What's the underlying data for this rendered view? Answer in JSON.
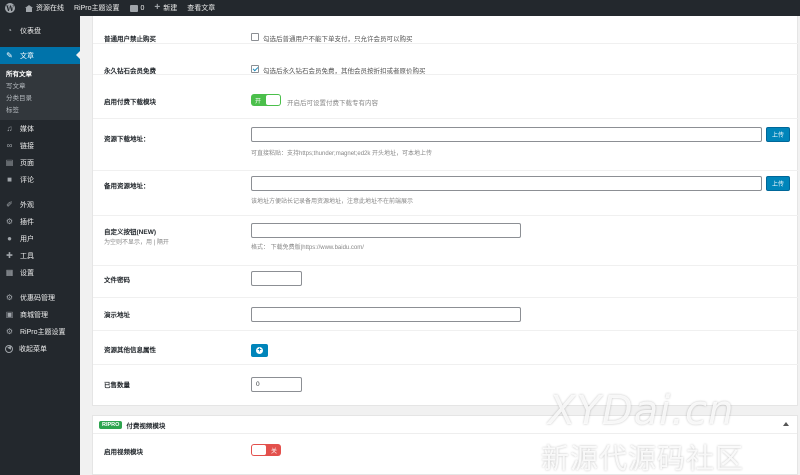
{
  "adminbar": {
    "site_name": "资源在线",
    "theme_settings": "RiPro主题设置",
    "comments_count": "0",
    "new_label": "新建",
    "view_post": "查看文章"
  },
  "sidebar": {
    "dashboard": "仪表盘",
    "posts": "文章",
    "submenu": [
      "所有文章",
      "写文章",
      "分类目录",
      "标签"
    ],
    "media": "媒体",
    "links": "链接",
    "pages": "页面",
    "comments": "评论",
    "appearance": "外观",
    "plugins": "插件",
    "users": "用户",
    "tools": "工具",
    "settings": "设置",
    "coupon": "优惠码管理",
    "shop": "商城管理",
    "ripro": "RiPro主题设置",
    "collapse": "收起菜单"
  },
  "form": {
    "no_buy_label": "普通用户禁止购买",
    "no_buy_text": "勾选后普通用户不能下单支付，只允许会员可以购买",
    "vip_free_label": "永久钻石会员免费",
    "vip_free_text": "勾选后永久钻石会员免费，其他会员按折扣或者原价购买",
    "paid_download_label": "启用付费下载模块",
    "paid_download_toggle": "开",
    "paid_download_desc": "开启后可设置付费下载专有内容",
    "download_url_label": "资源下载地址：",
    "download_url_value": "",
    "download_url_hint": "可直接粘贴：支持https;thunder;magnet;ed2k 开头地址，可本地上传",
    "upload_label": "上传",
    "backup_url_label": "备用资源地址：",
    "backup_url_value": "",
    "backup_url_hint": "该地址方便站长记录备用资源地址，注意此地址不在前端展示",
    "custom_btn_label": "自定义按钮(NEW)",
    "custom_btn_sublabel": "为空则不显示，用 | 隔开",
    "custom_btn_value": "",
    "custom_btn_hint": "格式： 下载免费版|https://www.baidu.com/",
    "file_password_label": "文件密码",
    "file_password_value": "",
    "demo_url_label": "演示地址",
    "demo_url_value": "",
    "other_info_label": "资源其他信息属性",
    "sold_count_label": "已售数量",
    "sold_count_value": "0"
  },
  "video": {
    "badge": "RIPRO",
    "title": "付费视频模块",
    "enable_label": "启用视频模块",
    "toggle": "关"
  },
  "watermark": {
    "line1": "XYDai.cn",
    "line2": "新源代源码社区"
  },
  "colors": {
    "admin_dark": "#23282d",
    "accent": "#0073aa",
    "toggle_on": "#4bbf4b",
    "toggle_off": "#e3504c"
  }
}
